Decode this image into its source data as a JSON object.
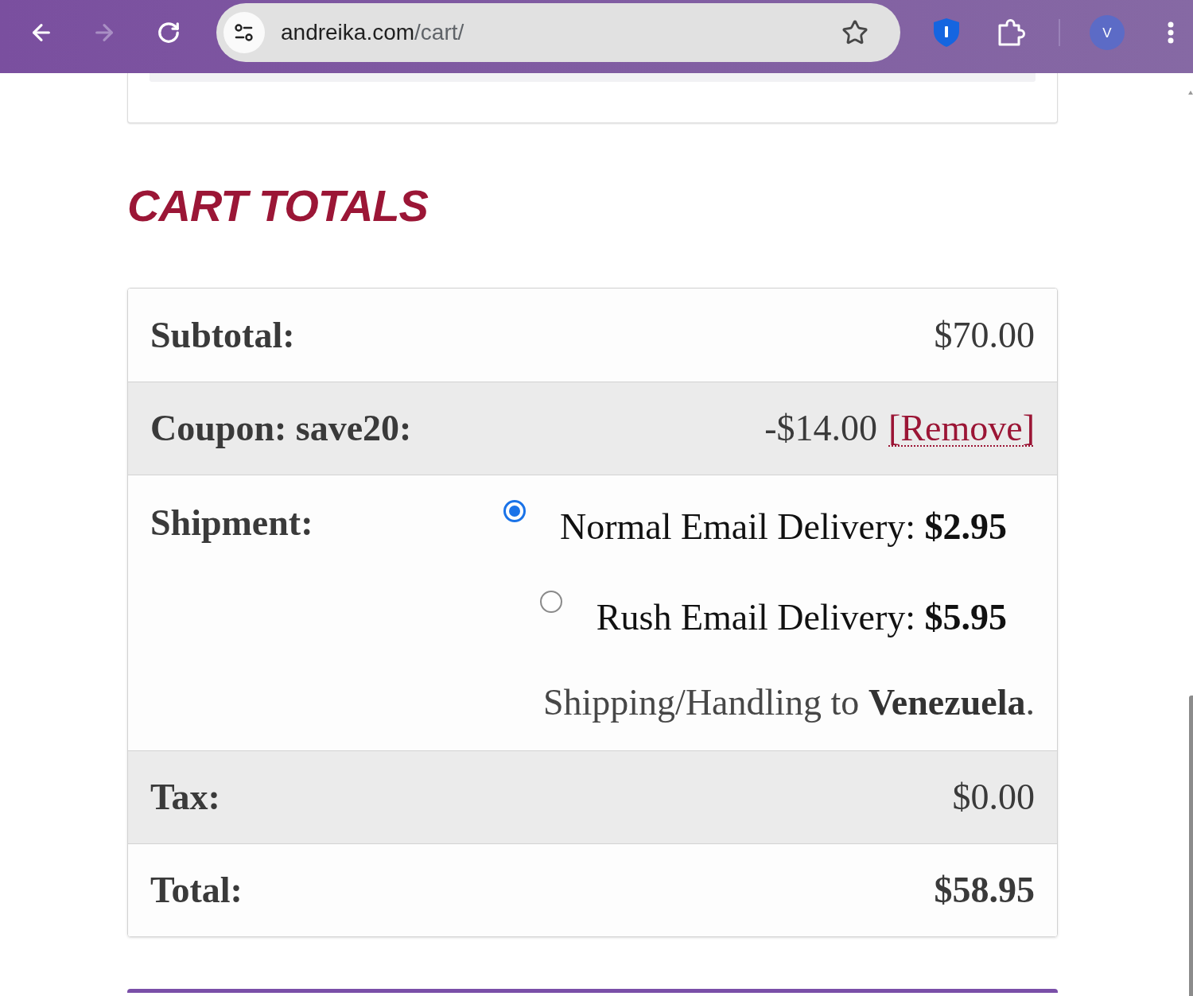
{
  "browser": {
    "nav": [
      {
        "kind": "back",
        "disabled": false
      },
      {
        "kind": "forward",
        "disabled": true
      },
      {
        "kind": "reload",
        "disabled": false
      }
    ],
    "url_host": "andreika.com",
    "url_path": "/cart/",
    "profile_initial": "V"
  },
  "heading": "CART TOTALS",
  "totals": {
    "rows": [
      {
        "kind": "amount",
        "label": "Subtotal:",
        "value": "$70.00"
      },
      {
        "kind": "coupon",
        "label": "Coupon: save20:",
        "value": "-$14.00",
        "link": "[Remove]"
      },
      {
        "kind": "shipping",
        "label": "Shipment:",
        "options": [
          {
            "text": "Normal Email Delivery: **$2.95**",
            "selected": true
          },
          {
            "text": "Rush Email Delivery: **$5.95**",
            "selected": false
          }
        ],
        "note": "Shipping/Handling to **Venezuela**."
      },
      {
        "kind": "amount",
        "label": "Tax:",
        "value": "$0.00"
      },
      {
        "kind": "total",
        "label": "Total:",
        "value": "$58.95"
      }
    ]
  }
}
